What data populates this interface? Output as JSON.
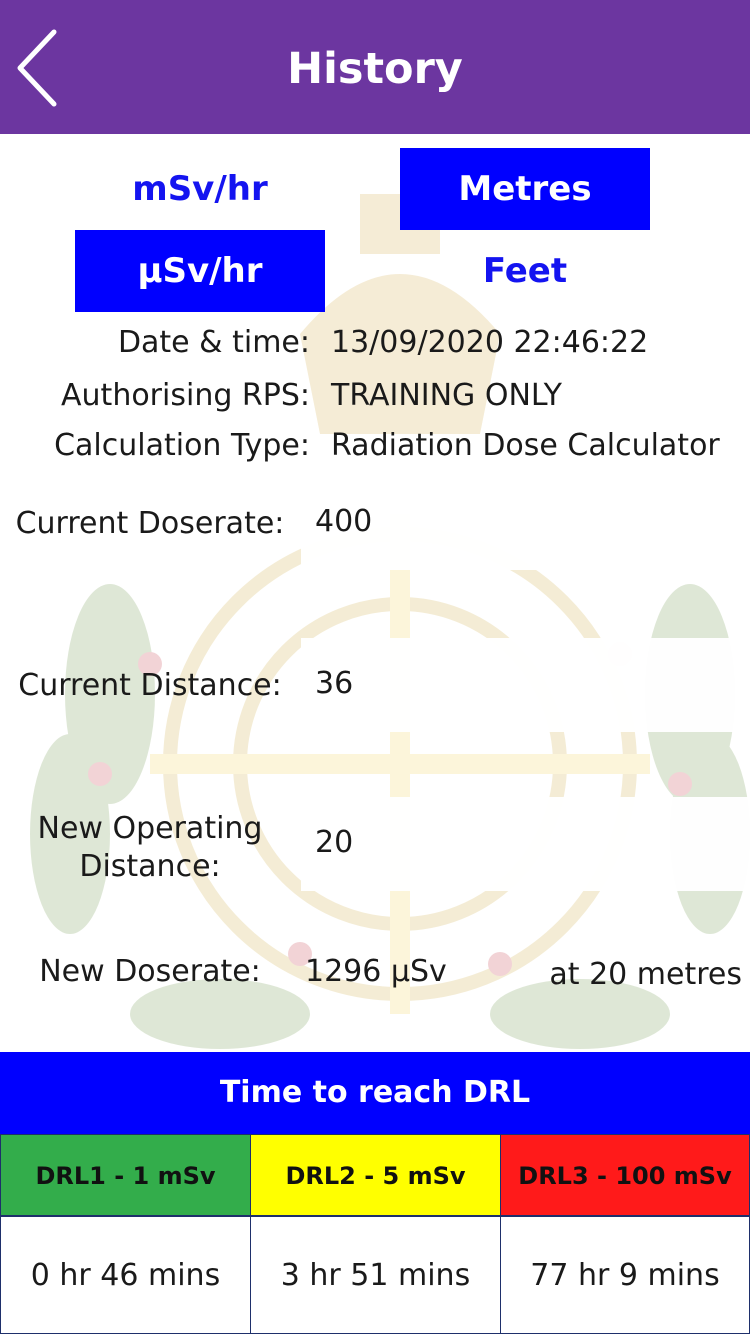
{
  "header": {
    "title": "History",
    "back_icon": "chevron-left-icon",
    "background": "#6c36a0"
  },
  "units": {
    "dose_options": [
      "mSv/hr",
      "μSv/hr"
    ],
    "dose_selected": "μSv/hr",
    "distance_options": [
      "Metres",
      "Feet"
    ],
    "distance_selected": "Metres"
  },
  "info": {
    "datetime_label": "Date & time:",
    "datetime_value": "13/09/2020 22:46:22",
    "rps_label": "Authorising RPS:",
    "rps_value": "TRAINING ONLY",
    "calc_type_label": "Calculation Type:",
    "calc_type_value": "Radiation Dose Calculator"
  },
  "fields": {
    "current_doserate_label": "Current Doserate:",
    "current_doserate_value": "400",
    "current_distance_label": "Current Distance:",
    "current_distance_value": "36",
    "new_distance_label_line1": "New Operating",
    "new_distance_label_line2": "Distance:",
    "new_distance_value": "20"
  },
  "result": {
    "label": "New Doserate:",
    "value": "1296 μSv",
    "at_text": "at 20 metres"
  },
  "drl": {
    "title": "Time to reach DRL",
    "columns": [
      {
        "label": "DRL1 - 1 mSv",
        "time": "0 hr 46 mins",
        "color": "#33ad4b"
      },
      {
        "label": "DRL2 - 5 mSv",
        "time": "3 hr 51 mins",
        "color": "#ffff00"
      },
      {
        "label": "DRL3 - 100 mSv",
        "time": "77 hr 9 mins",
        "color": "#ff1a1a"
      }
    ]
  },
  "colors": {
    "accent_blue": "#0000ff",
    "link_blue": "#1414f0"
  }
}
